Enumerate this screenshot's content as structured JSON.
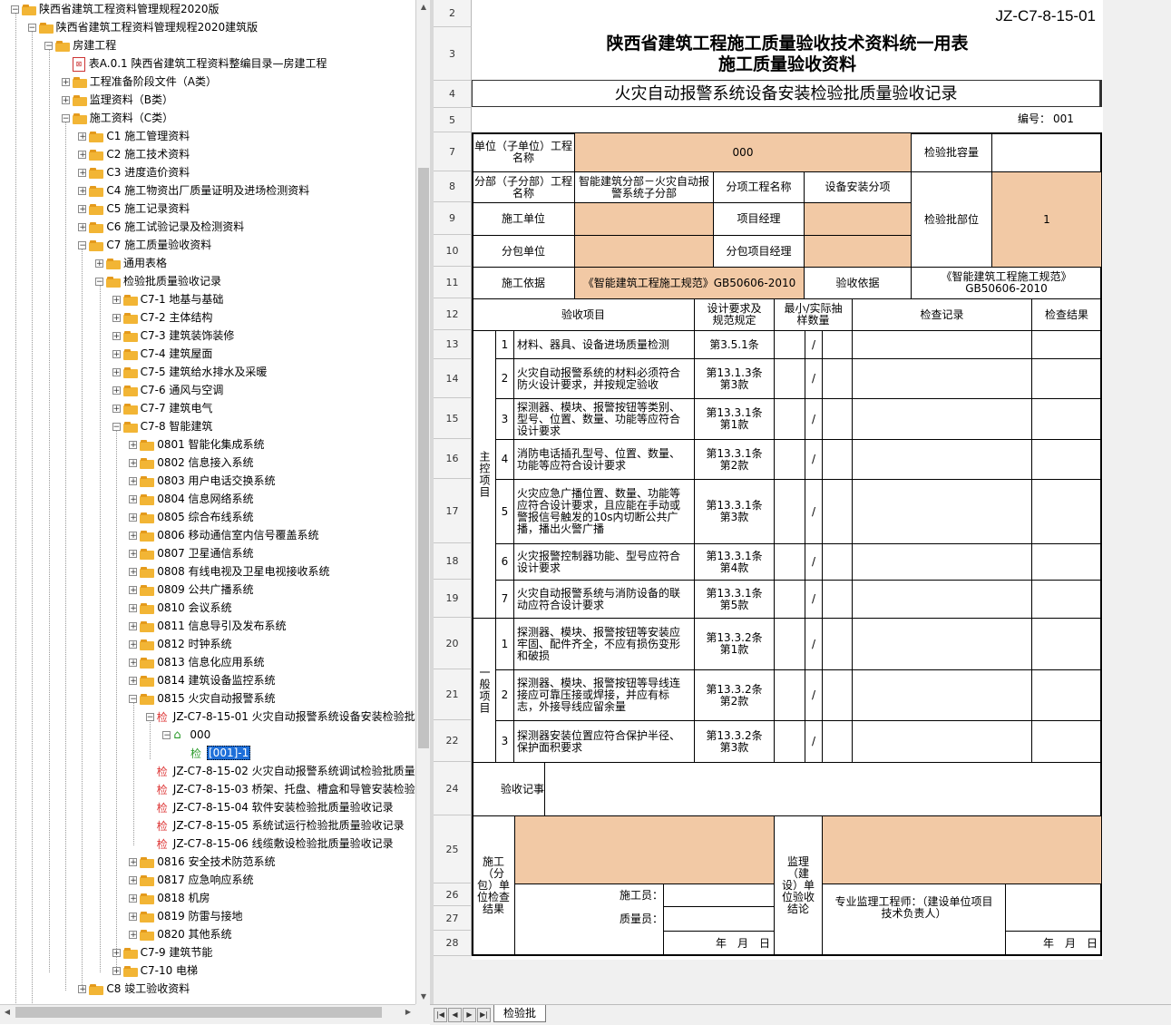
{
  "tree": {
    "nodes": [
      {
        "label": "陕西省建筑工程资料管理规程2020版",
        "exp": "-",
        "icon": "folder",
        "indent": 0
      },
      {
        "label": "陕西省建筑工程资料管理规程2020建筑版",
        "exp": "-",
        "icon": "folder",
        "indent": 1
      },
      {
        "label": "房建工程",
        "exp": "-",
        "icon": "folder",
        "indent": 2
      },
      {
        "label": "表A.0.1 陕西省建筑工程资料整编目录—房建工程",
        "exp": "",
        "icon": "pdf",
        "indent": 3
      },
      {
        "label": "工程准备阶段文件（A类）",
        "exp": "+",
        "icon": "folder",
        "indent": 3
      },
      {
        "label": "监理资料（B类）",
        "exp": "+",
        "icon": "folder",
        "indent": 3
      },
      {
        "label": "施工资料（C类）",
        "exp": "-",
        "icon": "folder",
        "indent": 3
      },
      {
        "label": "C1 施工管理资料",
        "exp": "+",
        "icon": "folder",
        "indent": 4
      },
      {
        "label": "C2 施工技术资料",
        "exp": "+",
        "icon": "folder",
        "indent": 4
      },
      {
        "label": "C3 进度造价资料",
        "exp": "+",
        "icon": "folder",
        "indent": 4
      },
      {
        "label": "C4 施工物资出厂质量证明及进场检测资料",
        "exp": "+",
        "icon": "folder",
        "indent": 4
      },
      {
        "label": "C5 施工记录资料",
        "exp": "+",
        "icon": "folder",
        "indent": 4
      },
      {
        "label": "C6 施工试验记录及检测资料",
        "exp": "+",
        "icon": "folder",
        "indent": 4
      },
      {
        "label": "C7 施工质量验收资料",
        "exp": "-",
        "icon": "folder",
        "indent": 4
      },
      {
        "label": "通用表格",
        "exp": "+",
        "icon": "folder",
        "indent": 5
      },
      {
        "label": "检验批质量验收记录",
        "exp": "-",
        "icon": "folder",
        "indent": 5
      },
      {
        "label": "C7-1 地基与基础",
        "exp": "+",
        "icon": "folder",
        "indent": 6
      },
      {
        "label": "C7-2 主体结构",
        "exp": "+",
        "icon": "folder",
        "indent": 6
      },
      {
        "label": "C7-3 建筑装饰装修",
        "exp": "+",
        "icon": "folder",
        "indent": 6
      },
      {
        "label": "C7-4 建筑屋面",
        "exp": "+",
        "icon": "folder",
        "indent": 6
      },
      {
        "label": "C7-5 建筑给水排水及采暖",
        "exp": "+",
        "icon": "folder",
        "indent": 6
      },
      {
        "label": "C7-6 通风与空调",
        "exp": "+",
        "icon": "folder",
        "indent": 6
      },
      {
        "label": "C7-7 建筑电气",
        "exp": "+",
        "icon": "folder",
        "indent": 6
      },
      {
        "label": "C7-8 智能建筑",
        "exp": "-",
        "icon": "folder",
        "indent": 6
      },
      {
        "label": "0801 智能化集成系统",
        "exp": "+",
        "icon": "folder",
        "indent": 7
      },
      {
        "label": "0802 信息接入系统",
        "exp": "+",
        "icon": "folder",
        "indent": 7
      },
      {
        "label": "0803 用户电话交换系统",
        "exp": "+",
        "icon": "folder",
        "indent": 7
      },
      {
        "label": "0804 信息网络系统",
        "exp": "+",
        "icon": "folder",
        "indent": 7
      },
      {
        "label": "0805 综合布线系统",
        "exp": "+",
        "icon": "folder",
        "indent": 7
      },
      {
        "label": "0806 移动通信室内信号覆盖系统",
        "exp": "+",
        "icon": "folder",
        "indent": 7
      },
      {
        "label": "0807 卫星通信系统",
        "exp": "+",
        "icon": "folder",
        "indent": 7
      },
      {
        "label": "0808 有线电视及卫星电视接收系统",
        "exp": "+",
        "icon": "folder",
        "indent": 7
      },
      {
        "label": "0809 公共广播系统",
        "exp": "+",
        "icon": "folder",
        "indent": 7
      },
      {
        "label": "0810 会议系统",
        "exp": "+",
        "icon": "folder",
        "indent": 7
      },
      {
        "label": "0811 信息导引及发布系统",
        "exp": "+",
        "icon": "folder",
        "indent": 7
      },
      {
        "label": "0812 时钟系统",
        "exp": "+",
        "icon": "folder",
        "indent": 7
      },
      {
        "label": "0813 信息化应用系统",
        "exp": "+",
        "icon": "folder",
        "indent": 7
      },
      {
        "label": "0814 建筑设备监控系统",
        "exp": "+",
        "icon": "folder",
        "indent": 7
      },
      {
        "label": "0815 火灾自动报警系统",
        "exp": "-",
        "icon": "folder",
        "indent": 7
      },
      {
        "label": "JZ-C7-8-15-01 火灾自动报警系统设备安装检验批",
        "exp": "-",
        "icon": "jian",
        "indent": 8
      },
      {
        "label": "000",
        "exp": "-",
        "icon": "home",
        "indent": 9
      },
      {
        "label": "[001]-1",
        "exp": "",
        "icon": "jian-green",
        "indent": 10,
        "selected": true
      },
      {
        "label": "JZ-C7-8-15-02 火灾自动报警系统调试检验批质量",
        "exp": "",
        "icon": "jian",
        "indent": 8
      },
      {
        "label": "JZ-C7-8-15-03 桥架、托盘、槽盒和导管安装检验",
        "exp": "",
        "icon": "jian",
        "indent": 8
      },
      {
        "label": "JZ-C7-8-15-04 软件安装检验批质量验收记录",
        "exp": "",
        "icon": "jian",
        "indent": 8
      },
      {
        "label": "JZ-C7-8-15-05 系统试运行检验批质量验收记录",
        "exp": "",
        "icon": "jian",
        "indent": 8
      },
      {
        "label": "JZ-C7-8-15-06 线缆敷设检验批质量验收记录",
        "exp": "",
        "icon": "jian",
        "indent": 8
      },
      {
        "label": "0816 安全技术防范系统",
        "exp": "+",
        "icon": "folder",
        "indent": 7
      },
      {
        "label": "0817 应急响应系统",
        "exp": "+",
        "icon": "folder",
        "indent": 7
      },
      {
        "label": "0818 机房",
        "exp": "+",
        "icon": "folder",
        "indent": 7
      },
      {
        "label": "0819 防雷与接地",
        "exp": "+",
        "icon": "folder",
        "indent": 7
      },
      {
        "label": "0820 其他系统",
        "exp": "+",
        "icon": "folder",
        "indent": 7
      },
      {
        "label": "C7-9 建筑节能",
        "exp": "+",
        "icon": "folder",
        "indent": 6
      },
      {
        "label": "C7-10 电梯",
        "exp": "+",
        "icon": "folder",
        "indent": 6
      },
      {
        "label": "C8 竣工验收资料",
        "exp": "+",
        "icon": "folder",
        "indent": 4
      }
    ]
  },
  "sheet": {
    "code": "JZ-C7-8-15-01",
    "title1": "陕西省建筑工程施工质量验收技术资料统一用表",
    "title2": "施工质量验收资料",
    "form_title": "火灾自动报警系统设备安装检验批质量验收记录",
    "number_label": "编号：",
    "number_value": "001",
    "unit_label": "单位（子单位）工程名称",
    "unit_value": "000",
    "capacity_label": "检验批容量",
    "capacity_value": "",
    "div_label": "分部（子分部）工程名称",
    "div_value": "智能建筑分部－火灾自动报警系统子分部",
    "sub_label": "分项工程名称",
    "sub_value": "设备安装分项",
    "location_label": "检验批部位",
    "location_value": "1",
    "contractor_label": "施工单位",
    "pm_label": "项目经理",
    "subcontractor_label": "分包单位",
    "sub_pm_label": "分包项目经理",
    "basis_label": "施工依据",
    "basis_value": "《智能建筑工程施工规范》GB50606-2010",
    "acc_basis_label": "验收依据",
    "acc_basis_value": "《智能建筑工程施工规范》GB50606-2010",
    "col_item": "验收项目",
    "col_design": "设计要求及规范规定",
    "col_sample": "最小/实际抽样数量",
    "col_record": "检查记录",
    "col_result": "检查结果",
    "main_group": "主控项目",
    "general_group": "一般项目",
    "slash": "/",
    "items": [
      {
        "no": "1",
        "text": "材料、器具、设备进场质量检测",
        "spec": "第3.5.1条"
      },
      {
        "no": "2",
        "text": "火灾自动报警系统的材料必须符合防火设计要求，并按规定验收",
        "spec": "第13.1.3条第3款"
      },
      {
        "no": "3",
        "text": "探测器、模块、报警按钮等类别、型号、位置、数量、功能等应符合设计要求",
        "spec": "第13.3.1条第1款"
      },
      {
        "no": "4",
        "text": "消防电话插孔型号、位置、数量、功能等应符合设计要求",
        "spec": "第13.3.1条第2款"
      },
      {
        "no": "5",
        "text": "火灾应急广播位置、数量、功能等应符合设计要求，且应能在手动或警报信号触发的10s内切断公共广播，播出火警广播",
        "spec": "第13.3.1条第3款"
      },
      {
        "no": "6",
        "text": "火灾报警控制器功能、型号应符合设计要求",
        "spec": "第13.3.1条第4款"
      },
      {
        "no": "7",
        "text": "火灾自动报警系统与消防设备的联动应符合设计要求",
        "spec": "第13.3.1条第5款"
      },
      {
        "no": "1",
        "text": "探测器、模块、报警按钮等安装应牢固、配件齐全，不应有损伤变形和破损",
        "spec": "第13.3.2条第1款"
      },
      {
        "no": "2",
        "text": "探测器、模块、报警按钮等导线连接应可靠压接或焊接，并应有标志，外接导线应留余量",
        "spec": "第13.3.2条第2款"
      },
      {
        "no": "3",
        "text": "探测器安装位置应符合保护半径、保护面积要求",
        "spec": "第13.3.2条第3款"
      }
    ],
    "remarks_label": "验收记事",
    "construct_check_label": "施工（分包）单位检查结果",
    "supervise_label": "监理（建设）单位验收结论",
    "worker_label": "施工员：",
    "quality_label": "质量员：",
    "engineer_label": "专业监理工程师：（建设单位项目技术负责人）",
    "date_label": "年　月　日",
    "row_numbers": [
      "2",
      "3",
      "4",
      "5",
      "7",
      "8",
      "9",
      "10",
      "11",
      "12",
      "13",
      "14",
      "15",
      "16",
      "17",
      "18",
      "19",
      "20",
      "21",
      "22",
      "24",
      "25",
      "26",
      "27",
      "28"
    ]
  },
  "tabs": {
    "active": "检验批"
  },
  "colors": {
    "peach": "#f2c9a5",
    "selected": "#1e6fd9"
  }
}
